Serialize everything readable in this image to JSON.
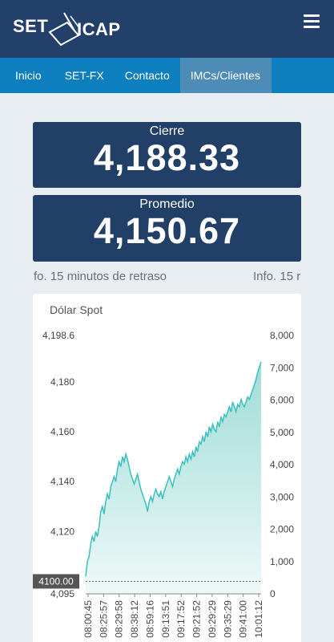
{
  "header": {
    "logo_left": "SET",
    "logo_right": "ICAP",
    "menu_icon": "hamburger-icon"
  },
  "nav": {
    "items": [
      {
        "label": "Inicio"
      },
      {
        "label": "SET-FX"
      },
      {
        "label": "Contacto"
      },
      {
        "label": "IMCs/Clientes"
      }
    ]
  },
  "cards": {
    "cierre": {
      "label": "Cierre",
      "value": "4,188.33"
    },
    "promedio": {
      "label": "Promedio",
      "value": "4,150.67"
    }
  },
  "ticker": {
    "text_a": "fo. 15 minutos de retraso",
    "text_b": "Info. 15 r"
  },
  "colors": {
    "header_bg": "#23406a",
    "nav_bg": "#0d7fbf",
    "nav_active": "#4e8cb8",
    "card_bg": "#223f67",
    "area_stroke": "#3cbfbf",
    "area_fill": "#bfe9e6"
  },
  "chart_data": {
    "type": "area",
    "title": "Dólar Spot",
    "y_left_ticks": [
      "4,198.6",
      "4,180",
      "4,160",
      "4,140",
      "4,120",
      "4,095"
    ],
    "y_left_range": [
      4095,
      4198.6
    ],
    "y_right_ticks": [
      "8,000",
      "7,000",
      "6,000",
      "5,000",
      "4,000",
      "3,000",
      "2,000",
      "1,000",
      "0"
    ],
    "y_right_range": [
      0,
      8000
    ],
    "x_ticks": [
      "08:00:45",
      "08:25:57",
      "08:29:58",
      "08:38:12",
      "08:59:16",
      "09:13:51",
      "09:17:52",
      "09:21:52",
      "09:29:29",
      "09:35:29",
      "09:41:00",
      "10:01:12"
    ],
    "reference_label": "4100.00",
    "reference_value": 4100,
    "grid": false,
    "series": [
      {
        "values": [
          4102,
          4108,
          4110,
          4115,
          4118,
          4116,
          4120,
          4118,
          4122,
          4128,
          4130,
          4127,
          4132,
          4135,
          4133,
          4138,
          4140,
          4142,
          4140,
          4145,
          4148,
          4146,
          4150,
          4148,
          4151,
          4149,
          4146,
          4143,
          4141,
          4139,
          4141,
          4143,
          4140,
          4137,
          4135,
          4133,
          4131,
          4128,
          4132,
          4134,
          4132,
          4135,
          4137,
          4135,
          4134,
          4136,
          4133,
          4136,
          4138,
          4140,
          4142,
          4140,
          4138,
          4141,
          4143,
          4145,
          4143,
          4146,
          4148,
          4147,
          4150,
          4148,
          4151,
          4149,
          4152,
          4150,
          4154,
          4152,
          4156,
          4155,
          4158,
          4156,
          4160,
          4158,
          4162,
          4160,
          4163,
          4161,
          4160,
          4164,
          4162,
          4166,
          4164,
          4167,
          4166,
          4168,
          4170,
          4168,
          4172,
          4170,
          4168,
          4171,
          4170,
          4173,
          4171,
          4170,
          4172,
          4174,
          4173,
          4175,
          4177,
          4179,
          4181,
          4184,
          4186,
          4188
        ]
      }
    ]
  }
}
